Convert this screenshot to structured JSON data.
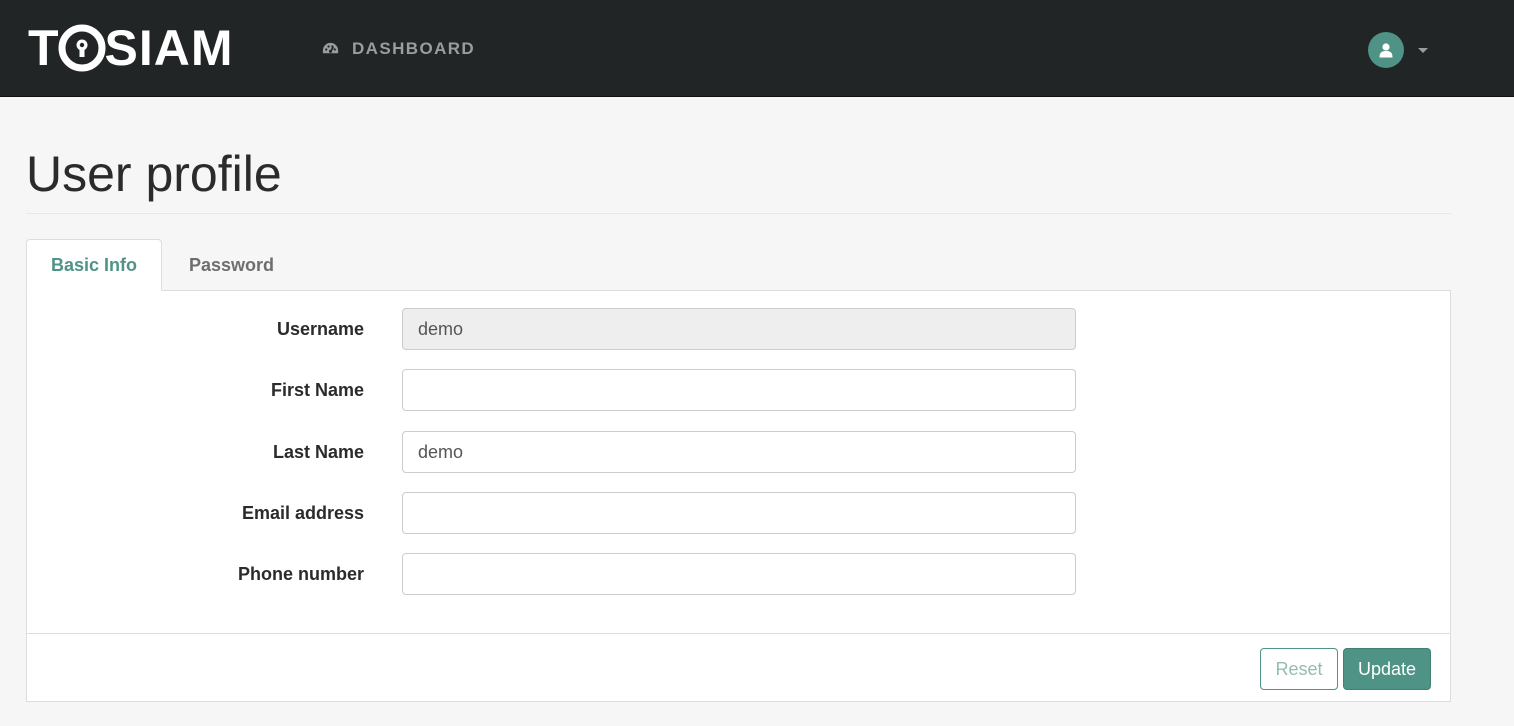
{
  "brand": {
    "letters_before": "T",
    "letters_after": "SIAM",
    "icon": "lock-o-icon"
  },
  "nav": {
    "dashboard_icon": "tachometer-icon",
    "dashboard_label": "DASHBOARD",
    "user_icon": "user-icon",
    "menu_icon": "caret-down-icon"
  },
  "page": {
    "title": "User profile"
  },
  "tabs": [
    {
      "label": "Basic Info",
      "active": true
    },
    {
      "label": "Password",
      "active": false
    }
  ],
  "form": {
    "fields": [
      {
        "label": "Username",
        "value": "demo",
        "readonly": true
      },
      {
        "label": "First Name",
        "value": ""
      },
      {
        "label": "Last Name",
        "value": "demo"
      },
      {
        "label": "Email address",
        "value": ""
      },
      {
        "label": "Phone number",
        "value": ""
      }
    ]
  },
  "actions": {
    "reset_label": "Reset",
    "update_label": "Update"
  },
  "colors": {
    "navbar": "#222526",
    "accent": "#4e9385",
    "background": "#f6f6f6"
  }
}
